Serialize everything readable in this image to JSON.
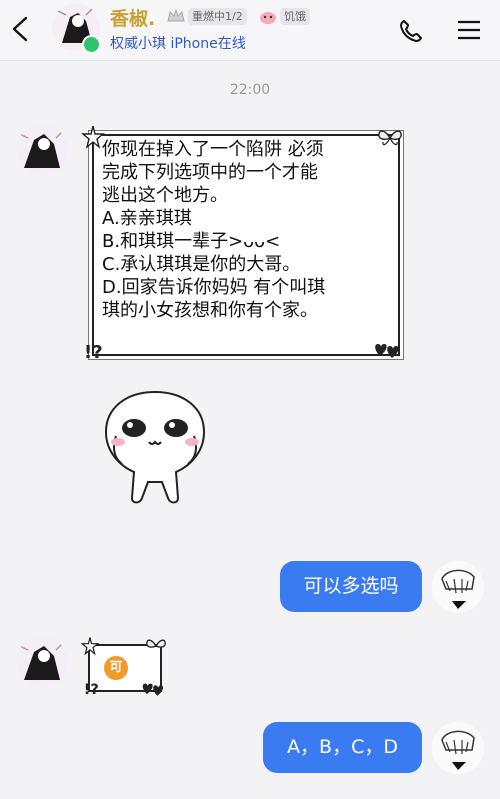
{
  "header": {
    "contact_name": "香椒.",
    "rank_badge": "重燃中1/2",
    "mood_label": "饥饿",
    "status": "权威小琪 iPhone在线"
  },
  "timestamp": "22:00",
  "messages": {
    "framed_lines": [
      "你现在掉入了一个陷阱 必须",
      "完成下列选项中的一个才能",
      "逃出这个地方。",
      "A.亲亲琪琪",
      "B.和琪琪一辈子>ᴗᴗ<",
      "C.承认琪琪是你的大哥。",
      "D.回家告诉你妈妈 有个叫琪",
      "琪的小女孩想和你有个家。"
    ],
    "outgoing_1": "可以多选吗",
    "small_badge": "可",
    "outgoing_2": "A，B，C，D"
  },
  "colors": {
    "accent_blue": "#3b7bf2",
    "name_gold": "#c9a233",
    "online_green": "#2dc46a",
    "badge_orange": "#f19a2a"
  },
  "icons": [
    "back-chevron-icon",
    "crown-icon",
    "mood-icon",
    "phone-icon",
    "menu-icon"
  ]
}
